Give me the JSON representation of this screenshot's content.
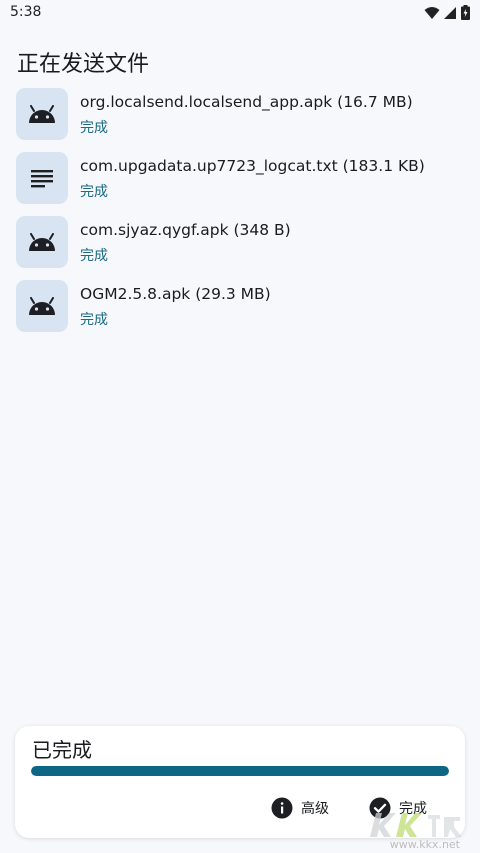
{
  "status_bar": {
    "time": "5:38",
    "icons": [
      "wifi-icon",
      "signal-icon",
      "battery-icon"
    ]
  },
  "header": {
    "title": "正在发送文件"
  },
  "files": [
    {
      "name": "org.localsend.localsend_app.apk (16.7 MB)",
      "status": "完成",
      "icon": "android-icon"
    },
    {
      "name": "com.upgadata.up7723_logcat.txt (183.1 KB)",
      "status": "完成",
      "icon": "text-file-icon"
    },
    {
      "name": "com.sjyaz.qygf.apk (348 B)",
      "status": "完成",
      "icon": "android-icon"
    },
    {
      "name": "OGM2.5.8.apk (29.3 MB)",
      "status": "完成",
      "icon": "android-icon"
    }
  ],
  "summary": {
    "status": "已完成",
    "progress": 1.0,
    "advanced_label": "高级",
    "done_label": "完成"
  },
  "watermark": {
    "text": "www.kkx.net"
  },
  "colors": {
    "accent": "#0e6685",
    "icon_bg": "#d8e4f1",
    "status_text": "#1a6b86",
    "background": "#f7f8fc"
  }
}
